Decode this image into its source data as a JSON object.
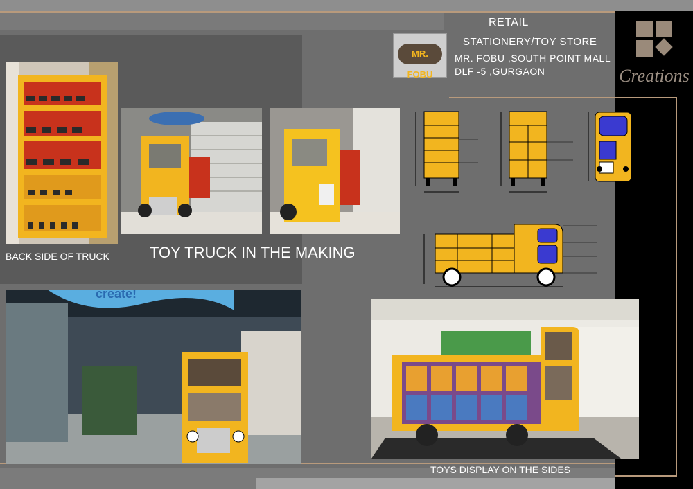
{
  "header": {
    "section": "RETAIL",
    "store_type": "STATIONERY/TOY STORE",
    "address_line1": "MR. FOBU ,SOUTH POINT MALL",
    "address_line2": "DLF -5 ,GURGAON"
  },
  "brand": {
    "logo_text": "Creations",
    "store_logo_text": "MR. FOBU"
  },
  "captions": {
    "back_side": "BACK SIDE OF TRUCK",
    "making": "TOY TRUCK IN THE MAKING",
    "display": "TOYS DISPLAY ON THE SIDES"
  },
  "store_sign": "create!",
  "colors": {
    "truck_yellow": "#f2b51f",
    "accent_tan": "#b89a7c",
    "shelf_red": "#d23a20"
  }
}
